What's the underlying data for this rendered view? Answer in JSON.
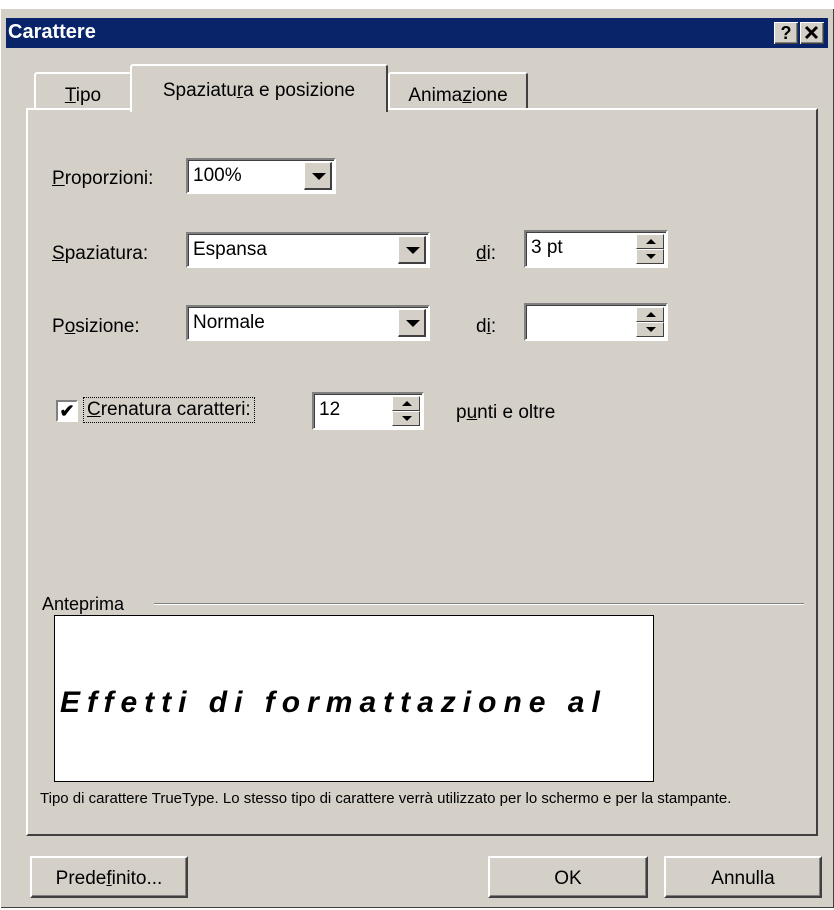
{
  "window": {
    "title": "Carattere",
    "help_label": "?",
    "close_label": "×"
  },
  "tabs": [
    {
      "label_pre": "",
      "accel": "T",
      "label_post": "ipo",
      "active": false
    },
    {
      "label_pre": "Spaziatu",
      "accel": "r",
      "label_post": "a e posizione",
      "active": true
    },
    {
      "label_pre": "Anima",
      "accel": "z",
      "label_post": "ione",
      "active": false
    }
  ],
  "proporzioni": {
    "label_accel": "P",
    "label_rest": "roporzioni:",
    "value": "100%"
  },
  "spaziatura": {
    "label_accel": "S",
    "label_rest": "paziatura:",
    "value": "Espansa",
    "di_accel": "d",
    "di_rest": "i:",
    "di_value": "3 pt"
  },
  "posizione": {
    "label_pre": "P",
    "label_accel": "o",
    "label_rest": "sizione:",
    "value": "Normale",
    "di_pre": "d",
    "di_accel": "i",
    "di_rest": ":",
    "di_value": ""
  },
  "crenatura": {
    "checked": true,
    "check_mark": "✔",
    "label_accel": "C",
    "label_rest": "renatura caratteri:",
    "value": "12",
    "suffix_pre": "p",
    "suffix_accel": "u",
    "suffix_rest": "nti e oltre"
  },
  "anteprima": {
    "label": "Anteprima",
    "sample_text": "Effetti di formattazione al"
  },
  "description": "Tipo di carattere TrueType. Lo stesso tipo di carattere verrà utilizzato per lo schermo e per la stampante.",
  "buttons": {
    "default_pre": "Prede",
    "default_accel": "f",
    "default_rest": "inito...",
    "ok": "OK",
    "cancel": "Annulla"
  }
}
